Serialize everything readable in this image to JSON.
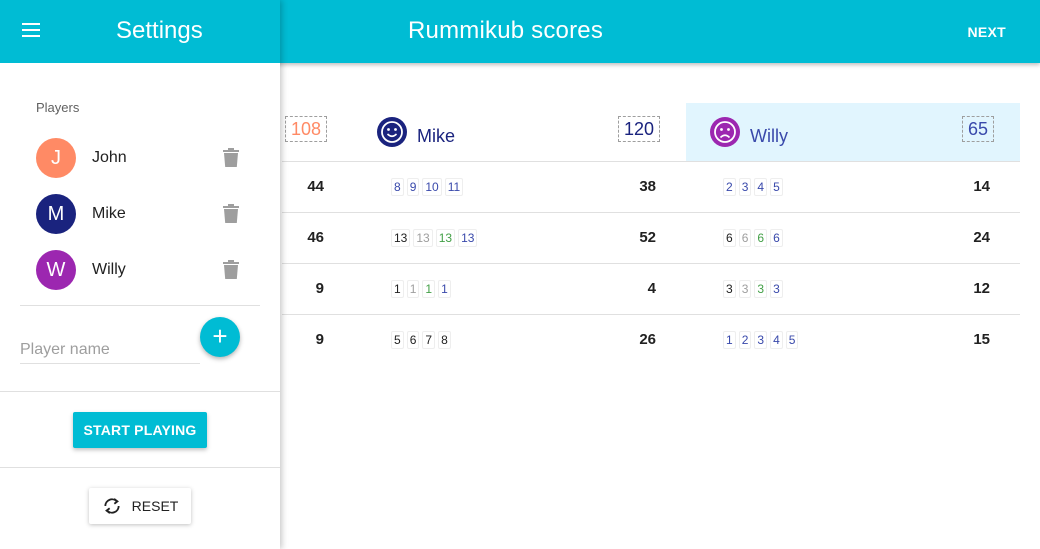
{
  "app": {
    "title": "Rummikub scores",
    "next_label": "NEXT"
  },
  "drawer": {
    "title": "Settings",
    "menu_icon": "hamburger-menu-icon",
    "players_label": "Players",
    "players": [
      {
        "initial": "J",
        "name": "John",
        "color": "#ff8a65"
      },
      {
        "initial": "M",
        "name": "Mike",
        "color": "#1a237e"
      },
      {
        "initial": "W",
        "name": "Willy",
        "color": "#9c27b0"
      }
    ],
    "player_name_placeholder": "Player name",
    "add_label": "+",
    "start_label": "START PLAYING",
    "reset_label": "RESET"
  },
  "table": {
    "columns": [
      {
        "name": "",
        "total": "108",
        "total_color": "#ff8a65",
        "face": "",
        "highlight": false
      },
      {
        "name": "Mike",
        "total": "120",
        "total_color": "#1a237e",
        "face": "happy-face-icon",
        "face_color": "#1a237e",
        "highlight": false
      },
      {
        "name": "Willy",
        "total": "65",
        "total_color": "#3f51b5",
        "face": "sad-face-icon",
        "face_color": "#9c27b0",
        "highlight": true,
        "highlight_color": "#e1f5fe"
      }
    ],
    "rows": [
      {
        "john_score": "44",
        "mike_tiles": [
          {
            "n": "8",
            "c": "#3949ab"
          },
          {
            "n": "9",
            "c": "#3949ab"
          },
          {
            "n": "10",
            "c": "#3949ab"
          },
          {
            "n": "11",
            "c": "#3949ab"
          }
        ],
        "mike_score": "38",
        "willy_tiles": [
          {
            "n": "2",
            "c": "#3949ab"
          },
          {
            "n": "3",
            "c": "#3949ab"
          },
          {
            "n": "4",
            "c": "#3949ab"
          },
          {
            "n": "5",
            "c": "#3949ab"
          }
        ],
        "willy_score": "14"
      },
      {
        "john_score": "46",
        "mike_tiles": [
          {
            "n": "13",
            "c": "#212121"
          },
          {
            "n": "13",
            "c": "#9e9e9e"
          },
          {
            "n": "13",
            "c": "#43a047"
          },
          {
            "n": "13",
            "c": "#3949ab"
          }
        ],
        "mike_score": "52",
        "willy_tiles": [
          {
            "n": "6",
            "c": "#212121"
          },
          {
            "n": "6",
            "c": "#9e9e9e"
          },
          {
            "n": "6",
            "c": "#43a047"
          },
          {
            "n": "6",
            "c": "#3949ab"
          }
        ],
        "willy_score": "24"
      },
      {
        "john_score": "9",
        "mike_tiles": [
          {
            "n": "1",
            "c": "#212121"
          },
          {
            "n": "1",
            "c": "#9e9e9e"
          },
          {
            "n": "1",
            "c": "#43a047"
          },
          {
            "n": "1",
            "c": "#3949ab"
          }
        ],
        "mike_score": "4",
        "willy_tiles": [
          {
            "n": "3",
            "c": "#212121"
          },
          {
            "n": "3",
            "c": "#9e9e9e"
          },
          {
            "n": "3",
            "c": "#43a047"
          },
          {
            "n": "3",
            "c": "#3949ab"
          }
        ],
        "willy_score": "12"
      },
      {
        "john_score": "9",
        "mike_tiles": [
          {
            "n": "5",
            "c": "#212121"
          },
          {
            "n": "6",
            "c": "#212121"
          },
          {
            "n": "7",
            "c": "#212121"
          },
          {
            "n": "8",
            "c": "#212121"
          }
        ],
        "mike_score": "26",
        "willy_tiles": [
          {
            "n": "1",
            "c": "#3949ab"
          },
          {
            "n": "2",
            "c": "#3949ab"
          },
          {
            "n": "3",
            "c": "#3949ab"
          },
          {
            "n": "4",
            "c": "#3949ab"
          },
          {
            "n": "5",
            "c": "#3949ab"
          }
        ],
        "willy_score": "15"
      }
    ]
  }
}
